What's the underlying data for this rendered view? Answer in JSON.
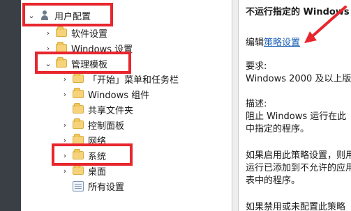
{
  "tree": {
    "root": {
      "label": "用户配置"
    },
    "root_children": [
      {
        "label": "软件设置"
      },
      {
        "label": "Windows 设置"
      }
    ],
    "admin_templates": {
      "label": "管理模板"
    },
    "admin_children": [
      {
        "label": "「开始」菜单和任务栏"
      },
      {
        "label": "Windows 组件"
      },
      {
        "label": "共享文件夹"
      },
      {
        "label": "控制面板"
      },
      {
        "label": "网络"
      },
      {
        "label": "系统"
      },
      {
        "label": "桌面"
      },
      {
        "label": "所有设置"
      }
    ]
  },
  "detail": {
    "title": "不运行指定的 Windows",
    "edit_prefix": "编辑",
    "edit_link": "策略设置",
    "requirements_label": "要求:",
    "requirements_value": "Windows 2000 及以上版",
    "description_label": "描述:",
    "description_lines": [
      "阻止 Windows 运行在此",
      "中指定的程序。"
    ],
    "if_enabled_lines": [
      "如果启用此策略设置，则用",
      "运行已添加到不允许的应用",
      "表中的程序。"
    ],
    "if_disabled_line": "如果禁用或未配置此策略"
  },
  "colors": {
    "highlight_box": "#e8262d",
    "link": "#1a5fb4",
    "folder": "#f6d37a",
    "strip": "#3a3f45"
  }
}
